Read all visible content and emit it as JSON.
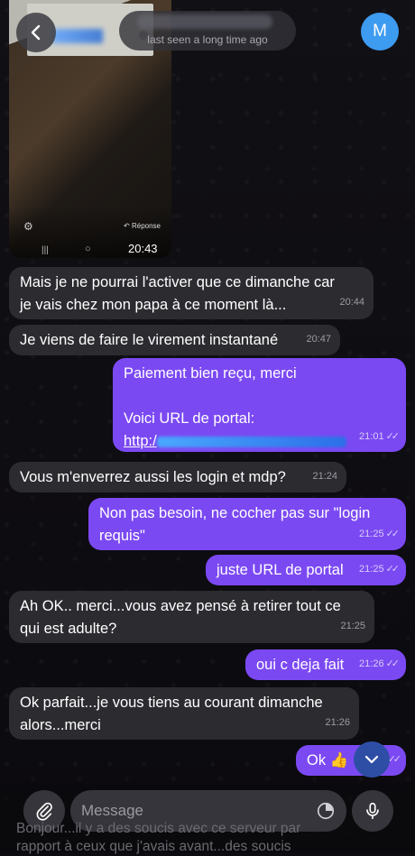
{
  "header": {
    "last_seen": "last seen a long time ago",
    "avatar_letter": "M"
  },
  "media": {
    "reply_label": "Réponse",
    "time": "20:43"
  },
  "messages": [
    {
      "dir": "in",
      "text_line1": "Mais je ne pourrai l'activer que ce dimanche car",
      "text_line2": "je vais chez mon papa à ce moment là...",
      "time": "20:44"
    },
    {
      "dir": "in",
      "text": "Je viens de faire le virement instantané",
      "time": "20:47"
    },
    {
      "dir": "out",
      "text_line1": "Paiement bien reçu, merci",
      "text_line2": "Voici URL de portal:",
      "link": "http:/",
      "time": "21:01"
    },
    {
      "dir": "in",
      "text": "Vous m'enverrez aussi les login et mdp?",
      "time": "21:24"
    },
    {
      "dir": "out",
      "text_line1": "Non pas besoin, ne cocher pas sur \"login",
      "text_line2": "requis\"",
      "time": "21:25"
    },
    {
      "dir": "out",
      "text": "juste URL de portal",
      "time": "21:25"
    },
    {
      "dir": "in",
      "text_line1": "Ah OK.. merci...vous avez pensé à retirer tout ce",
      "text_line2": "qui est adulte?",
      "time": "21:25"
    },
    {
      "dir": "out",
      "text": "oui c deja fait",
      "time": "21:26"
    },
    {
      "dir": "in",
      "text_line1": "Ok parfait...je vous tiens au courant dimanche",
      "text_line2": "alors...merci",
      "time": "21:26"
    },
    {
      "dir": "out",
      "text": "Ok 👍",
      "time": ""
    }
  ],
  "composer": {
    "placeholder": "Message",
    "preview_line1": "Bonjour...il y a des soucis avec ce serveur par",
    "preview_line2": "rapport à ceux que j'avais avant...des soucis"
  },
  "icons": [
    "back-chevron-icon",
    "paperclip-icon",
    "sticker-clock-icon",
    "microphone-icon",
    "chevron-down-icon",
    "double-check-icon"
  ],
  "colors": {
    "outgoing_bubble": "#7b49f2",
    "incoming_bubble": "#2c2b30",
    "avatar": "#3d9bf0",
    "scroll_button": "#2e4ea6"
  }
}
